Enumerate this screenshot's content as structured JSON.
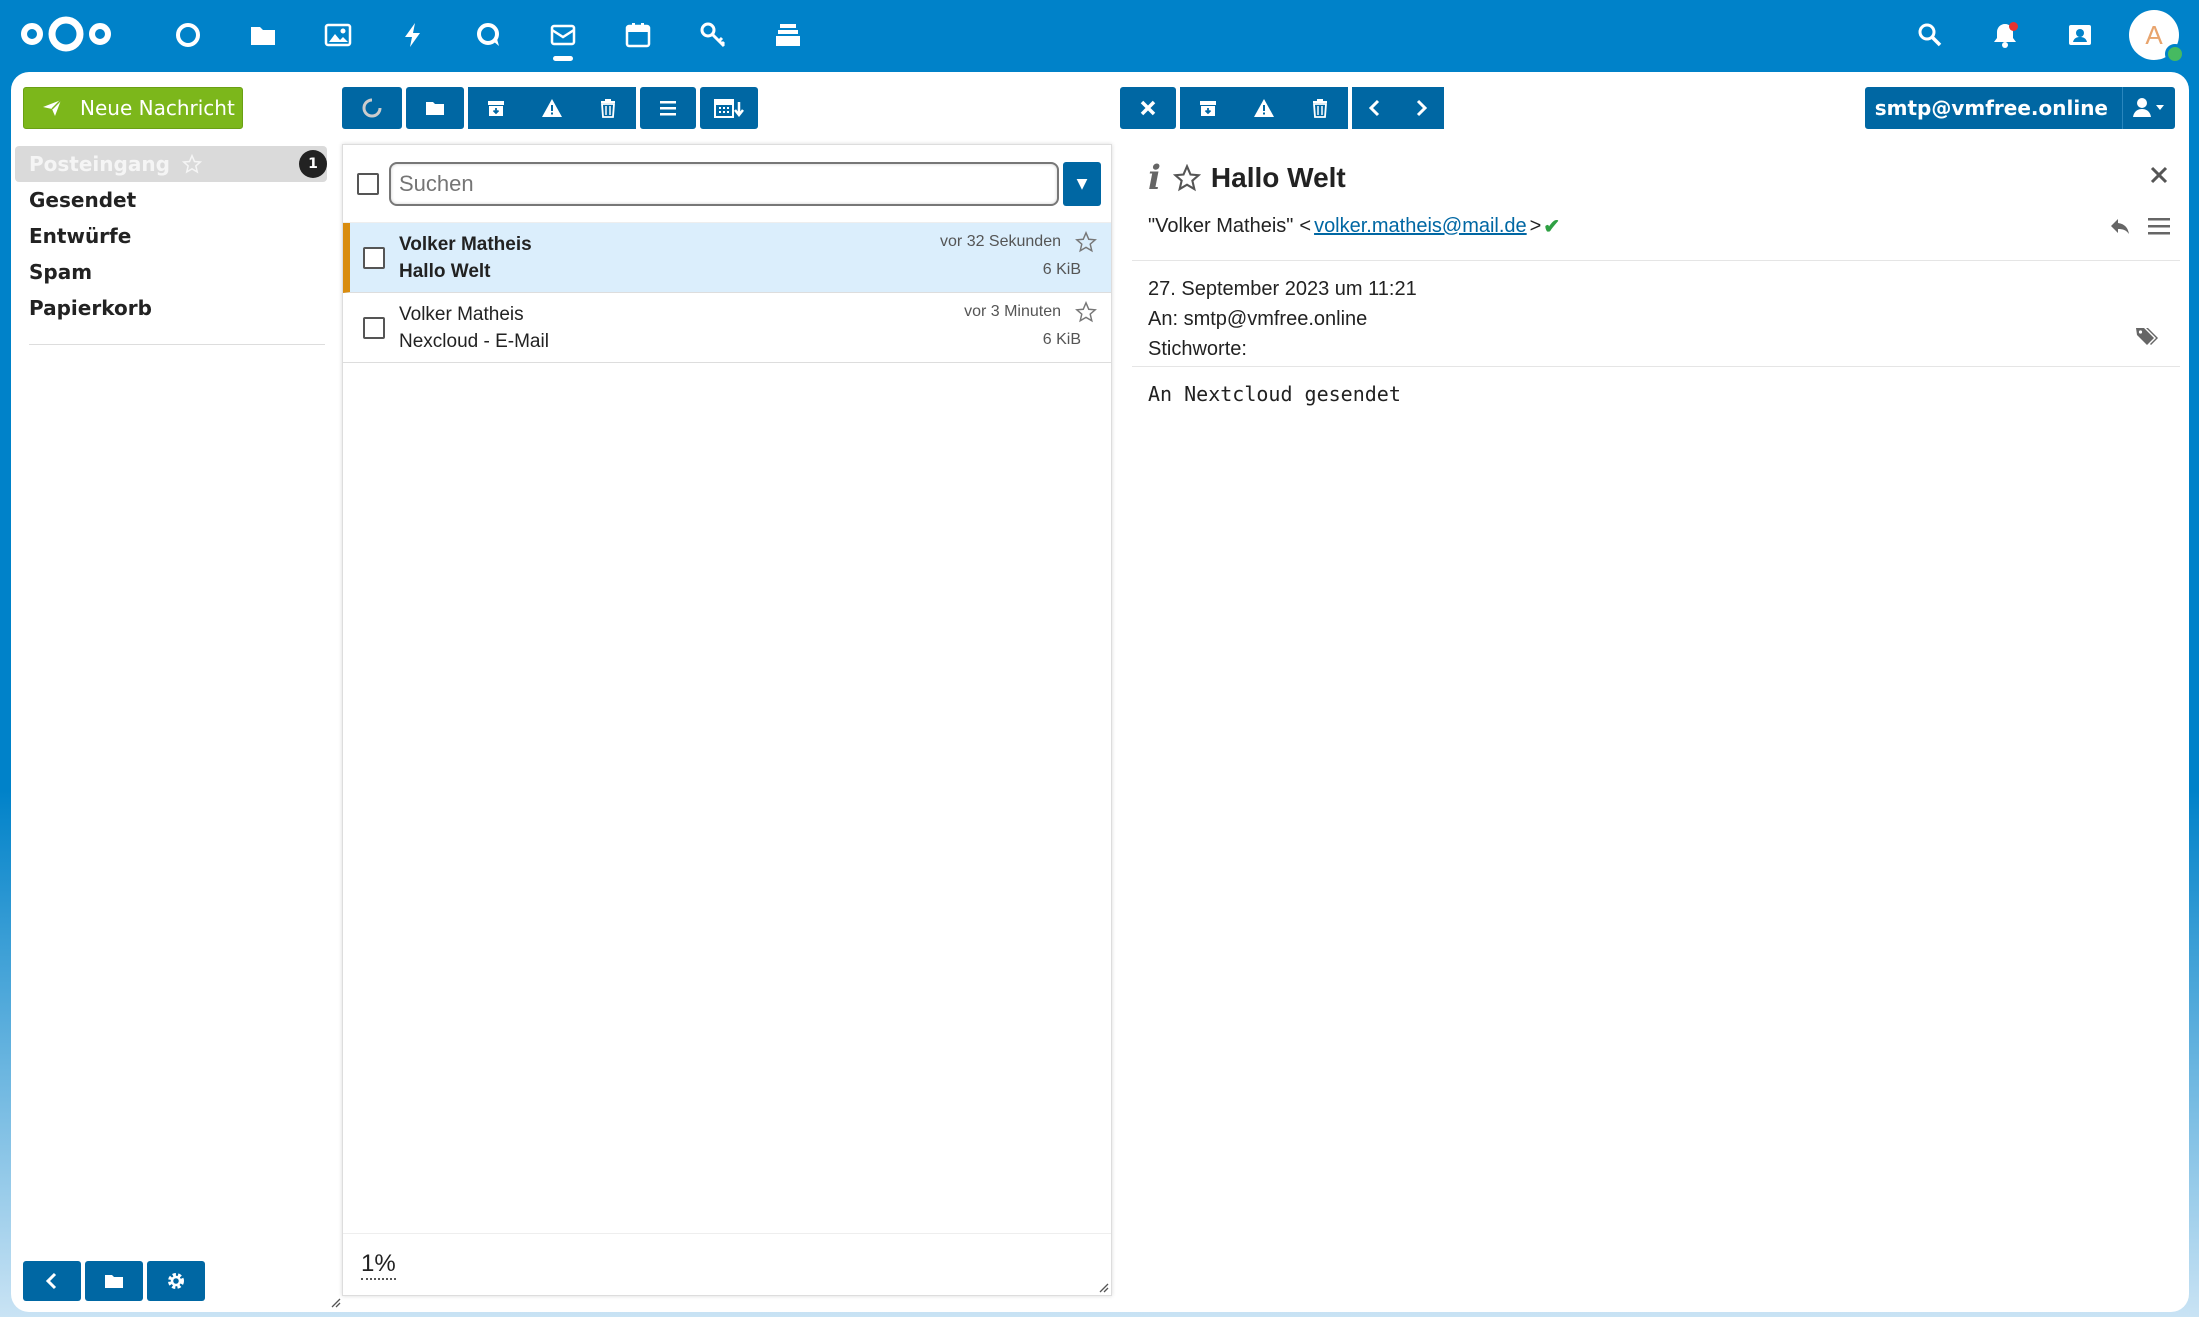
{
  "header": {
    "apps": [
      "dashboard-icon",
      "files-icon",
      "photos-icon",
      "activity-icon",
      "talk-icon",
      "mail-icon",
      "calendar-icon",
      "passwords-icon",
      "deck-icon"
    ],
    "active_app": "mail-icon",
    "right_icons": [
      "search-icon",
      "bell-icon",
      "contacts-icon"
    ],
    "avatar_letter": "A"
  },
  "sidebar": {
    "new_message_label": "Neue Nachricht",
    "folders": [
      {
        "label": "Posteingang",
        "active": true,
        "badge": "1"
      },
      {
        "label": "Gesendet"
      },
      {
        "label": "Entwürfe"
      },
      {
        "label": "Spam"
      },
      {
        "label": "Papierkorb"
      }
    ]
  },
  "account": {
    "label": "smtp@vmfree.online"
  },
  "list": {
    "search_placeholder": "Suchen",
    "messages": [
      {
        "from": "Volker Matheis",
        "subject": "Hallo Welt",
        "time": "vor 32 Sekunden",
        "size": "6 KiB",
        "unread": true,
        "selected": true
      },
      {
        "from": "Volker Matheis",
        "subject": "Nexcloud - E-Mail",
        "time": "vor 3 Minuten",
        "size": "6 KiB",
        "unread": false,
        "selected": false
      }
    ],
    "zoom": "1%"
  },
  "reader": {
    "subject": "Hallo Welt",
    "sender_name": "\"Volker Matheis\"",
    "sender_email": "volker.matheis@mail.de",
    "lt": "<",
    "gt": ">",
    "check": "✔",
    "date": "27. September 2023 um 11:21",
    "to": "An: smtp@vmfree.online",
    "tags_label": "Stichworte:",
    "body": "An Nextcloud gesendet"
  },
  "colors": {
    "brand": "#0082c9",
    "button": "#0067a3",
    "compose": "#7cb71b",
    "selected_bg": "#dbeefc",
    "selected_marker": "#d98c0e"
  }
}
